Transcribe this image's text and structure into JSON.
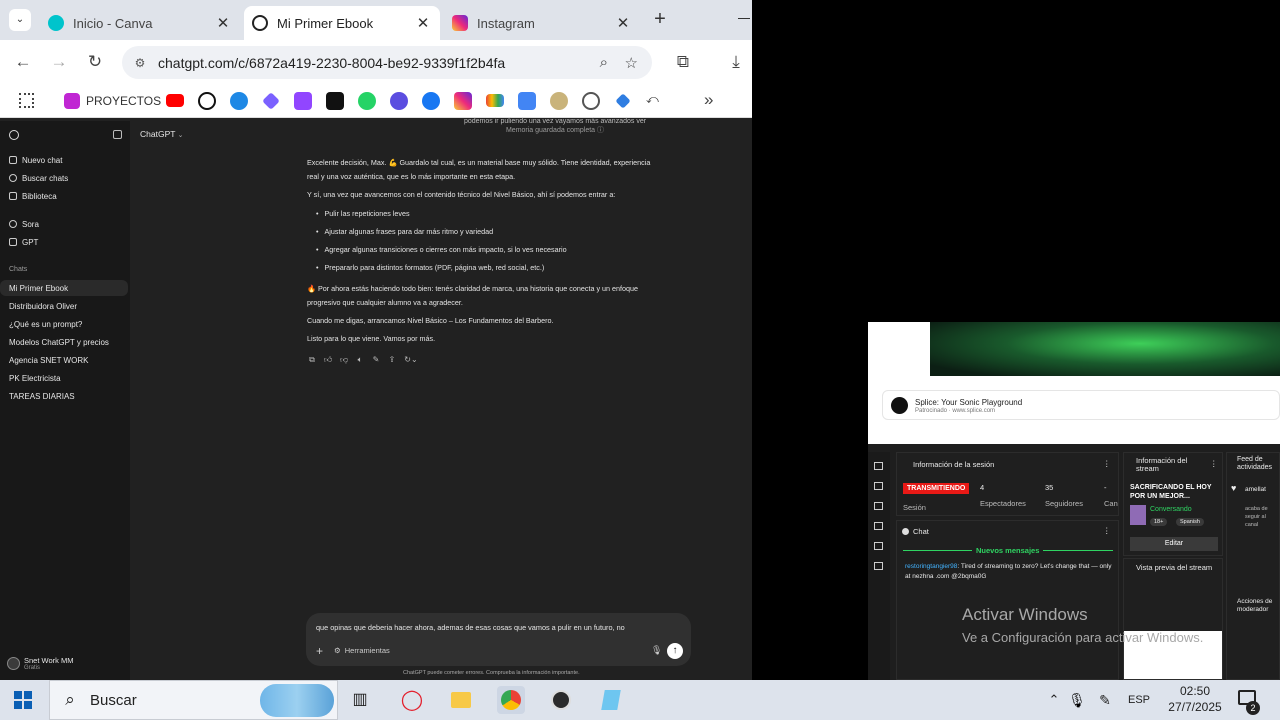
{
  "browser": {
    "tabs": [
      {
        "title": "Inicio - Canva",
        "favicon_color": "#00c4cc"
      },
      {
        "title": "Mi Primer Ebook",
        "favicon_color": "#222222"
      },
      {
        "title": "Instagram",
        "favicon_color": "#d62976"
      }
    ],
    "new_tab": "+",
    "url": "chatgpt.com/c/6872a419-2230-8004-be92-9339f1f2b4fa",
    "bookmarks_label": "PROYECTOS",
    "more_bookmarks": "»"
  },
  "chatgpt": {
    "model_selector": "ChatGPT",
    "sidebar": {
      "top_items": [
        "Nuevo chat",
        "Buscar chats",
        "Biblioteca"
      ],
      "apps": [
        "Sora",
        "GPT"
      ],
      "chats_heading": "Chats",
      "chats": [
        "Mi Primer Ebook",
        "Distribuidora Oliver",
        "¿Qué es un prompt?",
        "Modelos ChatGPT y precios",
        "Agencia SNET WORK",
        "PK Electricista",
        "TAREAS DIARIAS"
      ],
      "user_name": "Snet Work MM",
      "user_plan": "Gratis"
    },
    "memory_line": "podemos ir puliendo una vez vayamos más avanzados ver",
    "memory_saved": "Memoria guardada completa",
    "paragraphs": [
      "Excelente decisión, Max. 💪 Guardalo tal cual, es un material base muy sólido. Tiene identidad, experiencia",
      "real y una voz auténtica, que es lo más importante en esta etapa.",
      "Y sí, una vez que avancemos con el contenido técnico del Nivel Básico, ahí sí podemos entrar a:"
    ],
    "bullets": [
      "Pulir las repeticiones leves",
      "Ajustar algunas frases para dar más ritmo y variedad",
      "Agregar algunas transiciones o cierres con más impacto, si lo ves necesario",
      "Prepararlo para distintos formatos (PDF, página web, red social, etc.)"
    ],
    "closing": [
      "🔥 Por ahora estás haciendo todo bien: tenés claridad de marca, una historia que conecta y un enfoque",
      "progresivo que cualquier alumno va a agradecer.",
      "Cuando me digas, arrancamos Nivel Básico – Los Fundamentos del Barbero.",
      "Listo para lo que viene. Vamos por más."
    ],
    "input_value": "que opinas que deberia hacer ahora, ademas de esas cosas que vamos a pulir en un futuro, no",
    "tools_label": "Herramientas",
    "disclaimer": "ChatGPT puede cometer errores. Comprueba la información importante."
  },
  "stream": {
    "ad_title": "Splice: Your Sonic Playground",
    "ad_sub": "Patrocinado · www.splice.com",
    "session_title": "Información de la sesión",
    "live_badge": "TRANSMITIENDO",
    "session_label": "Sesión",
    "viewers_value": "4",
    "viewers_label": "Espectadores",
    "followers_value": "35",
    "followers_label": "Seguidores",
    "more_value": "-",
    "more_label": "Can subs",
    "chat_title": "Chat",
    "new_messages": "Nuevos mensajes",
    "chat_user": "restoringtangier98",
    "chat_message": "Tired of streaming to zero? Let's change that — only at nezhna .com @2bqma0G",
    "info_title": "Información del stream",
    "stream_title": "SACRIFICANDO EL HOY POR UN MEJOR...",
    "category": "Conversando",
    "tag_age": "18+",
    "tag_lang": "Spanish",
    "edit_button": "Editar",
    "preview_title": "Vista previa del stream",
    "activity_title": "Feed de actividades",
    "activity_user": "amellat",
    "activity_text": "acaba de seguir al canal",
    "mod_actions": "Acciones de moderador",
    "activate_title": "Activar Windows",
    "activate_sub": "Ve a Configuración para activar Windows."
  },
  "taskbar": {
    "search_placeholder": "Buscar",
    "language": "ESP",
    "time": "02:50",
    "date": "27/7/2025",
    "notifications": "2"
  }
}
